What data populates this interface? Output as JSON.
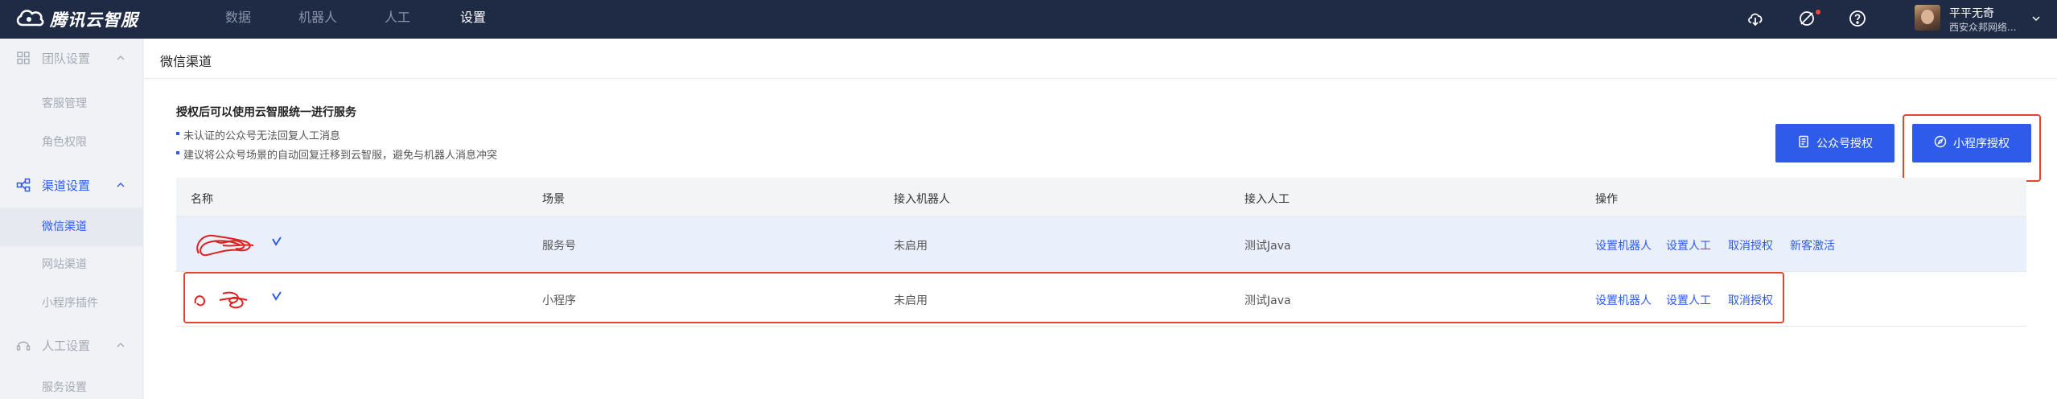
{
  "brand": {
    "name": "腾讯云智服",
    "logo_icon": "cloud-logo-icon"
  },
  "top_nav": [
    {
      "label": "数据",
      "active": false
    },
    {
      "label": "机器人",
      "active": false
    },
    {
      "label": "人工",
      "active": false
    },
    {
      "label": "设置",
      "active": true
    }
  ],
  "top_icons": [
    "cloud-download-icon",
    "notification-off-icon",
    "help-icon"
  ],
  "user": {
    "name": "平平无奇",
    "org": "西安众邦网络..."
  },
  "sidebar": {
    "groups": [
      {
        "label": "团队设置",
        "icon": "grid-icon",
        "active": false,
        "items": [
          "客服管理",
          "角色权限"
        ]
      },
      {
        "label": "渠道设置",
        "icon": "share-nodes-icon",
        "active": true,
        "items": [
          "微信渠道",
          "网站渠道",
          "小程序插件"
        ]
      },
      {
        "label": "人工设置",
        "icon": "headset-icon",
        "active": false,
        "items": [
          "服务设置"
        ]
      }
    ],
    "active_item": "微信渠道"
  },
  "page": {
    "title": "微信渠道",
    "info_title": "授权后可以使用云智服统一进行服务",
    "info_lines": [
      "未认证的公众号无法回复人工消息",
      "建议将公众号场景的自动回复迁移到云智服，避免与机器人消息冲突"
    ],
    "buttons": {
      "official_account": "公众号授权",
      "mini_program": "小程序授权"
    }
  },
  "table": {
    "headers": [
      "名称",
      "场景",
      "接入机器人",
      "接入人工",
      "操作"
    ],
    "rows": [
      {
        "scene": "服务号",
        "robot": "未启用",
        "agent": "测试Java",
        "ops": [
          "设置机器人",
          "设置人工",
          "取消授权",
          "新客激活"
        ]
      },
      {
        "scene": "小程序",
        "robot": "未启用",
        "agent": "测试Java",
        "ops": [
          "设置机器人",
          "设置人工",
          "取消授权"
        ]
      }
    ]
  },
  "colors": {
    "topbar": "#1f2a44",
    "accent": "#2f5bea",
    "highlight": "#e7432e",
    "redaction": "#e02020"
  }
}
